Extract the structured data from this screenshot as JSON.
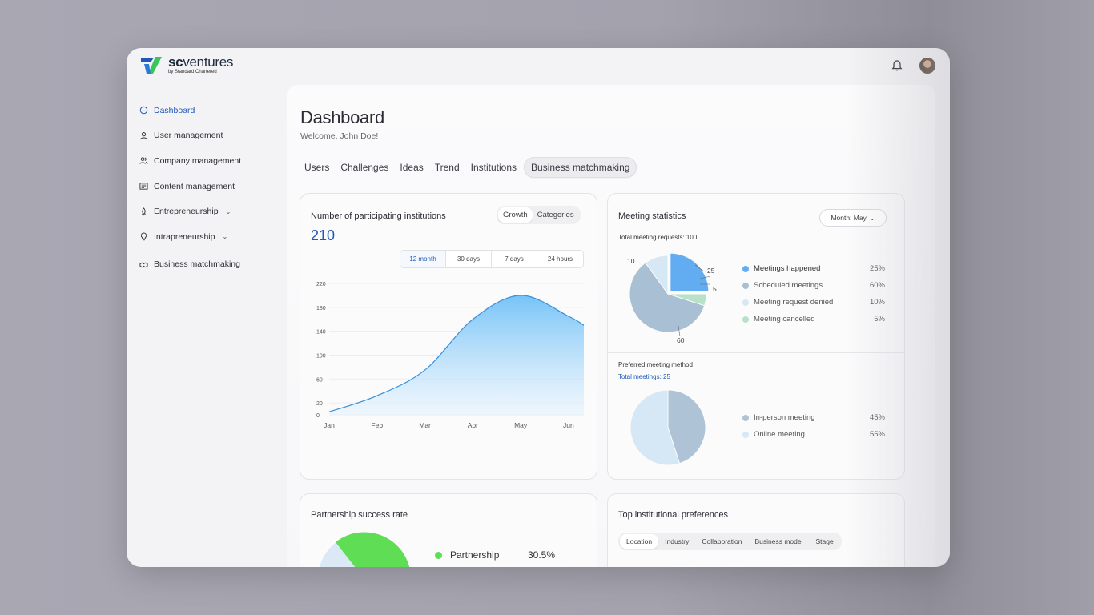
{
  "brand": {
    "name_bold": "sc",
    "name_rest": "ventures",
    "tagline": "by Standard Chartered"
  },
  "sidebar": {
    "items": [
      {
        "label": "Dashboard",
        "icon": "dashboard-icon",
        "active": true
      },
      {
        "label": "User management",
        "icon": "user-icon"
      },
      {
        "label": "Company management",
        "icon": "users-icon"
      },
      {
        "label": "Content management",
        "icon": "content-icon"
      },
      {
        "label": "Entrepreneurship",
        "icon": "rocket-icon",
        "chevron": "chevron-down-icon"
      },
      {
        "label": "Intrapreneurship",
        "icon": "bulb-icon",
        "chevron": "chevron-down-icon"
      },
      {
        "label": "Business matchmaking",
        "icon": "handshake-icon"
      }
    ]
  },
  "header": {
    "title": "Dashboard",
    "welcome": "Welcome, John Doe!"
  },
  "tabs": [
    "Users",
    "Challenges",
    "Ideas",
    "Trend",
    "Institutions",
    "Business matchmaking"
  ],
  "active_tab": "Business matchmaking",
  "institutions_card": {
    "title": "Number of participating institutions",
    "total": "210",
    "toggle": [
      "Growth",
      "Categories"
    ],
    "ranges": [
      "12 month",
      "30 days",
      "7 days",
      "24 hours"
    ]
  },
  "meeting_card": {
    "title": "Meeting statistics",
    "dropdown": "Month: May",
    "total_label": "Total meeting requests: 100",
    "legend": [
      {
        "label": "Meetings happened",
        "value": "25%",
        "color": "#62acf2"
      },
      {
        "label": "Scheduled meetings",
        "value": "60%",
        "color": "#a9bfd3"
      },
      {
        "label": "Meeting request denied",
        "value": "10%",
        "color": "#d7e8f5"
      },
      {
        "label": "Meeting cancelled",
        "value": "5%",
        "color": "#b9e0c8"
      }
    ],
    "pie_labels": {
      "a": "10",
      "b": "25",
      "c": "5",
      "d": "60"
    },
    "method_title": "Preferred meeting method",
    "method_total": "Total meetings: 25",
    "method_legend": [
      {
        "label": "In-person meeting",
        "value": "45%",
        "color": "#afc3d6"
      },
      {
        "label": "Online meeting",
        "value": "55%",
        "color": "#d6e7f5"
      }
    ]
  },
  "partnership_card": {
    "title": "Partnership success rate",
    "legend_label": "Partnership",
    "legend_value": "30.5%",
    "color": "#5fdd55"
  },
  "preferences_card": {
    "title": "Top institutional preferences",
    "tabs": [
      "Location",
      "Industry",
      "Collaboration",
      "Business model",
      "Stage"
    ]
  },
  "chart_data": [
    {
      "type": "area",
      "categories": [
        "Jan",
        "Feb",
        "Mar",
        "Apr",
        "May",
        "Jun"
      ],
      "yticks": [
        0,
        20,
        60,
        100,
        140,
        180,
        220
      ],
      "ylim": [
        0,
        220
      ],
      "series": [
        {
          "values": [
            5,
            32,
            75,
            160,
            200,
            165
          ]
        }
      ]
    },
    {
      "type": "pie",
      "categories": [
        "Meetings happened",
        "Scheduled meetings",
        "Meeting request denied",
        "Meeting cancelled"
      ],
      "values": [
        25,
        60,
        10,
        5
      ]
    },
    {
      "type": "pie",
      "categories": [
        "In-person meeting",
        "Online meeting"
      ],
      "values": [
        45,
        55
      ]
    }
  ]
}
